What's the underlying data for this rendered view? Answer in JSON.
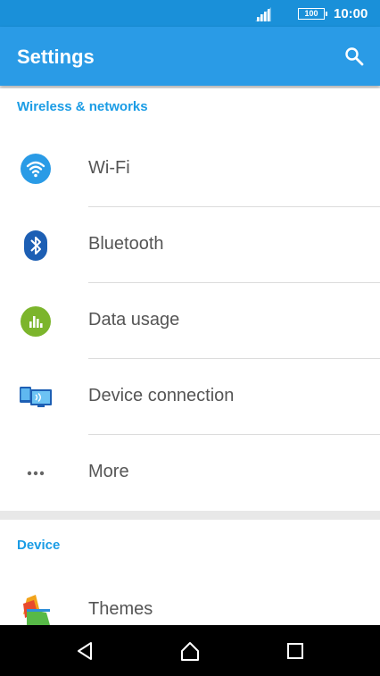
{
  "status": {
    "battery": "100",
    "time": "10:00"
  },
  "appbar": {
    "title": "Settings",
    "search_icon": "search-icon"
  },
  "sections": {
    "wireless": {
      "title": "Wireless & networks",
      "items": [
        {
          "label": "Wi-Fi",
          "icon": "wifi-icon"
        },
        {
          "label": "Bluetooth",
          "icon": "bluetooth-icon"
        },
        {
          "label": "Data usage",
          "icon": "data-usage-icon"
        },
        {
          "label": "Device connection",
          "icon": "device-connection-icon"
        },
        {
          "label": "More",
          "icon": "more-icon"
        }
      ]
    },
    "device": {
      "title": "Device",
      "items": [
        {
          "label": "Themes",
          "icon": "themes-icon"
        }
      ]
    }
  },
  "navbar": {
    "back": "back-icon",
    "home": "home-icon",
    "recents": "recents-icon"
  },
  "colors": {
    "status_bar": "#1a90d9",
    "app_bar": "#2a9be6",
    "section_header": "#1a9ce5"
  }
}
